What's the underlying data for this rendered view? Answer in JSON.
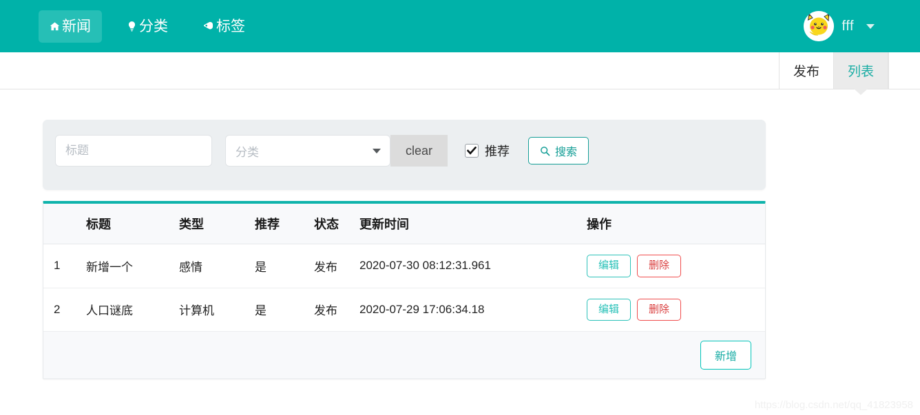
{
  "navbar": {
    "items": [
      {
        "label": "新闻",
        "icon": "home-icon",
        "active": true
      },
      {
        "label": "分类",
        "icon": "bulb-icon",
        "active": false
      },
      {
        "label": "标签",
        "icon": "tag-icon",
        "active": false
      }
    ],
    "user": {
      "name": "fff",
      "avatar": "pikachu-avatar"
    },
    "background_color": "#00b2a9",
    "active_item_color": "#26bfb6"
  },
  "tabs": [
    {
      "label": "发布",
      "active": false
    },
    {
      "label": "列表",
      "active": true
    }
  ],
  "filter": {
    "title_placeholder": "标题",
    "title_value": "",
    "category_placeholder": "分类",
    "category_value": "",
    "clear_label": "clear",
    "recommend_label": "推荐",
    "recommend_checked": true,
    "search_label": "搜索",
    "search_icon": "magnifier-icon",
    "panel_color": "#eceff1"
  },
  "table": {
    "accent_color": "#0fb3ab",
    "headers": [
      "",
      "标题",
      "类型",
      "推荐",
      "状态",
      "更新时间",
      "操作"
    ],
    "rows": [
      {
        "index": "1",
        "title": "新增一个",
        "type": "感情",
        "recommend": "是",
        "status": "发布",
        "updated": "2020-07-30 08:12:31.961",
        "edit_label": "编辑",
        "delete_label": "删除"
      },
      {
        "index": "2",
        "title": "人口谜底",
        "type": "计算机",
        "recommend": "是",
        "status": "发布",
        "updated": "2020-07-29 17:06:34.18",
        "edit_label": "编辑",
        "delete_label": "删除"
      }
    ],
    "add_label": "新增"
  },
  "watermark": "https://blog.csdn.net/qq_41823958"
}
